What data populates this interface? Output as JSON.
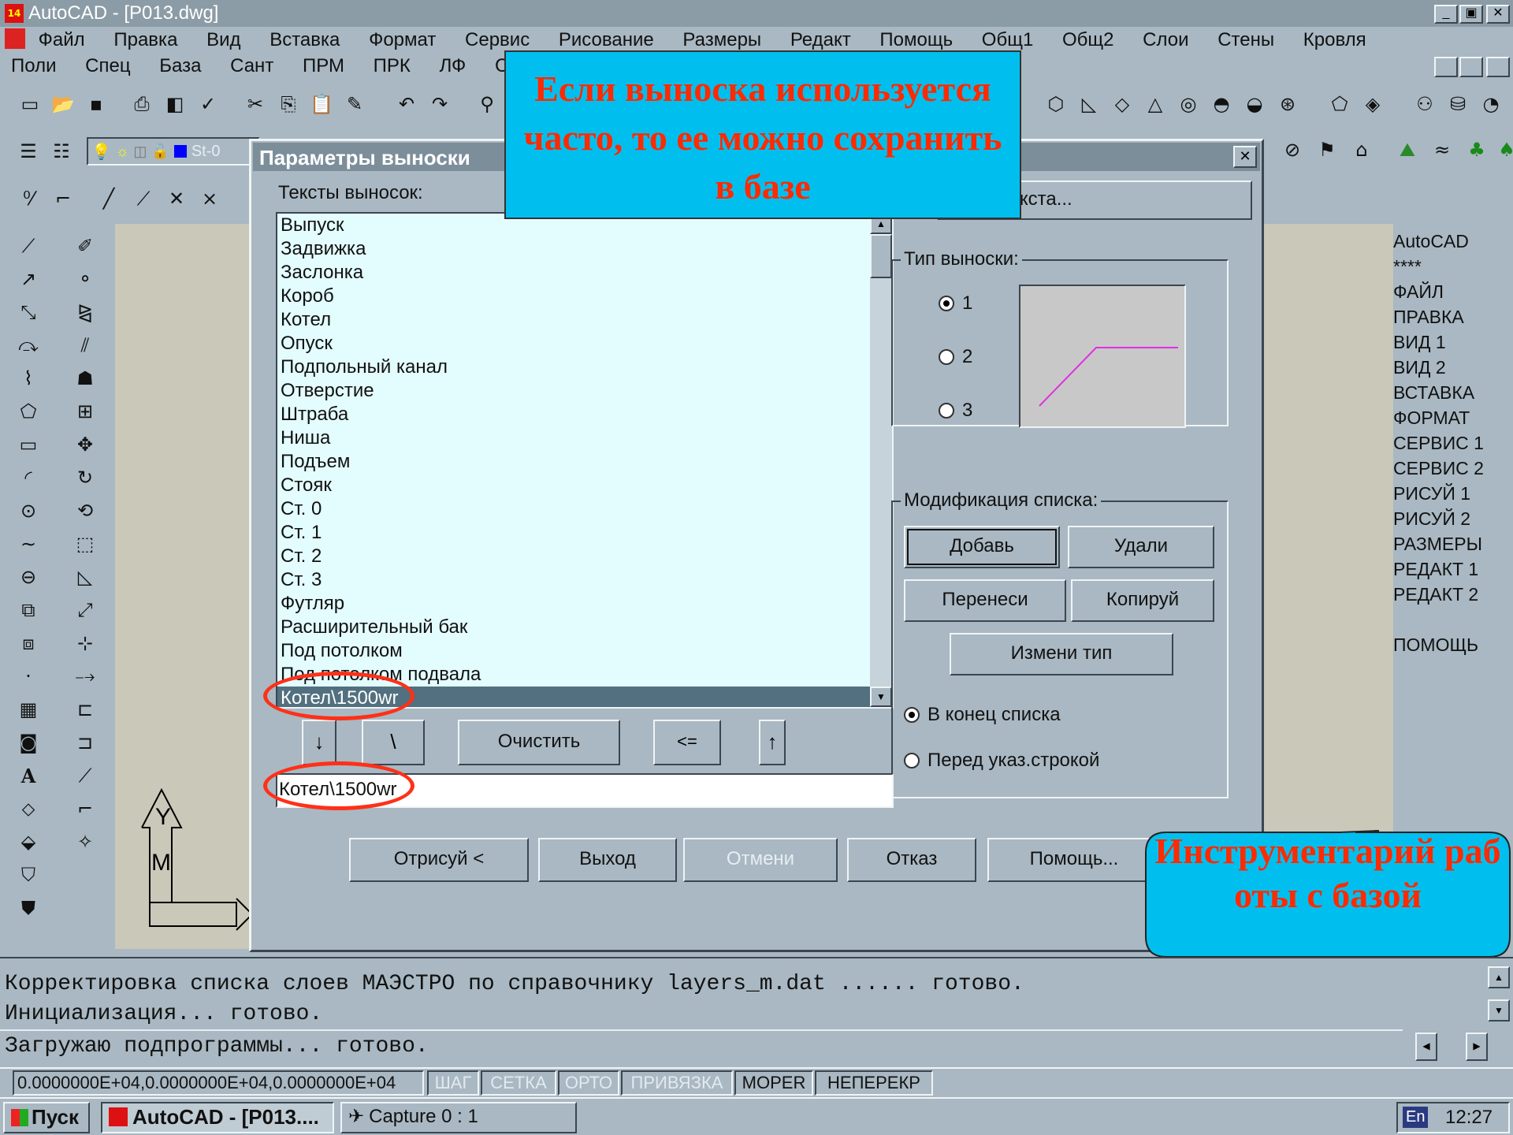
{
  "window": {
    "title": "AutoCAD - [P013.dwg]",
    "controls": [
      "_",
      "▣",
      "✕"
    ]
  },
  "menubar1": [
    "Файл",
    "Правка",
    "Вид",
    "Вставка",
    "Формат",
    "Сервис",
    "Рисование",
    "Размеры",
    "Редакт",
    "Помощь",
    "Общ1",
    "Общ2",
    "Слои",
    "Стены",
    "Кровля"
  ],
  "menubar2": [
    "Поли",
    "Спец",
    "База",
    "Сант",
    "ПРМ",
    "ПРК",
    "ЛФ",
    "С"
  ],
  "layer_fragment": "St-0",
  "dialog": {
    "title": "Параметры выноски",
    "close": "✕",
    "list_label": "Тексты выносок:",
    "items": [
      "Выпуск",
      "Задвижка",
      "Заслонка",
      "Короб",
      "Котел",
      "Опуск",
      "Подпольный канал",
      "Отверстие",
      "Штраба",
      "Ниша",
      "Подъем",
      "Стояк",
      "Ст. 0",
      "Ст. 1",
      "Ст. 2",
      "Ст. 3",
      "Футляр",
      "Расширительный бак",
      "Под потолком",
      "Под потолком подвала",
      "Котел\\1500wr"
    ],
    "selected_index": 20,
    "text_params_button": "етры текста...",
    "leader_group": "Тип выноски:",
    "leader_options": [
      "1",
      "2",
      "3"
    ],
    "leader_selected": "1",
    "modify_group": "Модификация списка:",
    "buttons": {
      "add": "Добавь",
      "delete": "Удали",
      "move": "Перенеси",
      "copy": "Копируй",
      "change_type": "Измени тип"
    },
    "position_options": [
      "В конец списка",
      "Перед указ.строкой"
    ],
    "position_selected": "В конец списка",
    "small_buttons": {
      "down": "↓",
      "backslash": "\\",
      "clear": "Очистить",
      "back": "<=",
      "up": "↑"
    },
    "edit_value": "Котел\\1500wr",
    "bottom_buttons": {
      "draw": "Отрисуй <",
      "exit": "Выход",
      "undo": "Отмени",
      "cancel": "Отказ",
      "help": "Помощь..."
    }
  },
  "callout_top": "Если выноска используется часто, то ее можно сохранить в базе",
  "callout_bottom": "Инструментарий работы с базой",
  "screen_menu": [
    "AutoCAD",
    "****",
    "ФАЙЛ",
    "ПРАВКА",
    "ВИД 1",
    "ВИД 2",
    "ВСТАВКА",
    "ФОРМАТ",
    "СЕРВИС 1",
    "СЕРВИС 2",
    "РИСУЙ 1",
    "РИСУЙ 2",
    "РАЗМЕРЫ",
    "РЕДАКТ 1",
    "РЕДАКТ 2",
    "",
    "ПОМОЩЬ"
  ],
  "command_lines": [
    "Корректировка списка слоев МАЭСТРО по справочнику layers_m.dat ...... готово.",
    "Инициализация... готово.",
    "Загружаю подпрограммы... готово."
  ],
  "status": {
    "coords": "0.0000000E+04,0.0000000E+04,0.0000000E+04",
    "toggles": [
      "ШАГ",
      "СЕТКА",
      "ОРТО",
      "ПРИВЯЗКА",
      "MOPER",
      "НЕПЕРЕКР"
    ]
  },
  "ucs": {
    "y": "Y",
    "m": "M"
  },
  "taskbar": {
    "start": "Пуск",
    "app1": "AutoCAD - [P013....",
    "app2": "Capture 0 : 1",
    "lang": "En",
    "time": "12:27"
  },
  "colors": {
    "dialog_bg": "#a9b8c2",
    "list_bg": "#e3fcfe",
    "selection": "#52707f",
    "callout": "#00bfef",
    "callout_text": "#ff2a00",
    "ellipse": "#ff3018",
    "leader_line": "#e030e0",
    "titlebar": "#8c9ca6"
  }
}
